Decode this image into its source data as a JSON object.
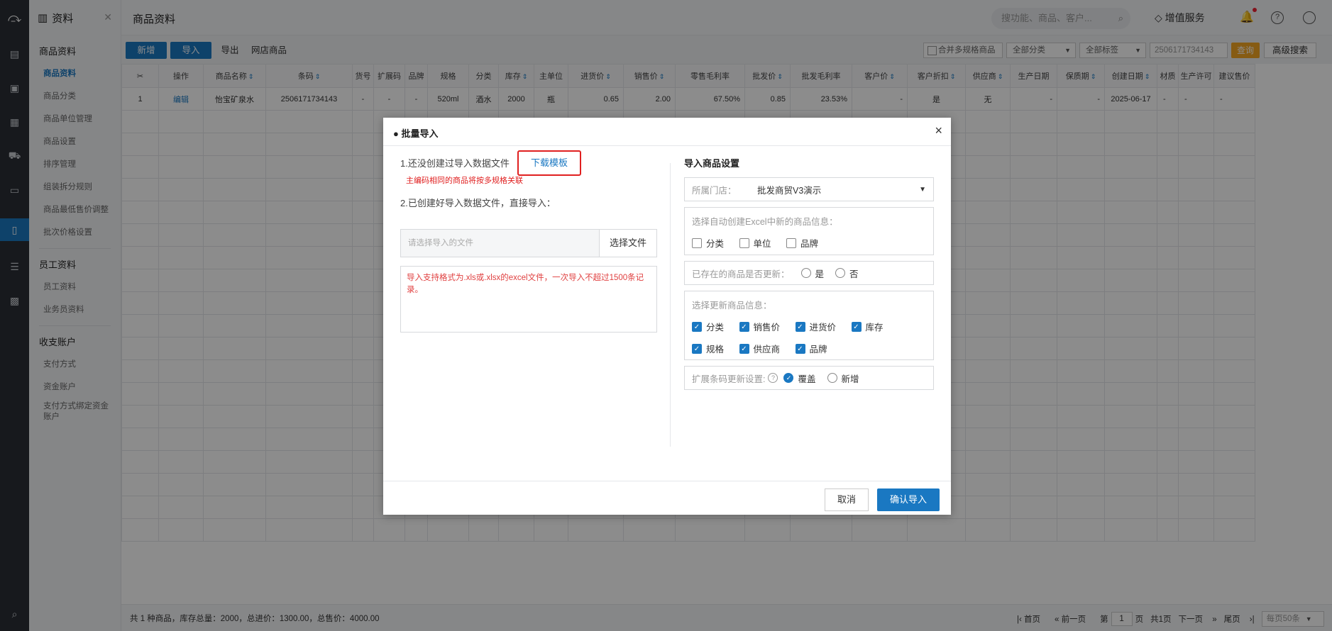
{
  "sidebar": {
    "title": "资料",
    "groups": [
      {
        "label": "商品资料",
        "items": [
          "商品资料",
          "商品分类",
          "商品单位管理",
          "商品设置",
          "排序管理",
          "组装拆分规则",
          "商品最低售价调整",
          "批次价格设置"
        ]
      },
      {
        "label": "员工资料",
        "items": [
          "员工资料",
          "业务员资料"
        ]
      },
      {
        "label": "收支账户",
        "items": [
          "支付方式",
          "资金账户",
          "支付方式绑定资金账户"
        ]
      }
    ]
  },
  "header": {
    "title": "商品资料",
    "search_placeholder": "搜功能、商品、客户...",
    "value_added": "增值服务"
  },
  "toolbar": {
    "new": "新增",
    "import": "导入",
    "export": "导出",
    "online": "网店商品",
    "merge_spec": "合并多规格商品",
    "category": "全部分类",
    "tag": "全部标签",
    "search_value": "2506171734143",
    "query": "查询",
    "advanced": "高级搜索"
  },
  "table": {
    "headers": [
      "",
      "操作",
      "商品名称",
      "条码",
      "货号",
      "扩展码",
      "品牌",
      "规格",
      "分类",
      "库存",
      "主单位",
      "进货价",
      "销售价",
      "零售毛利率",
      "批发价",
      "批发毛利率",
      "客户价",
      "客户折扣",
      "供应商",
      "生产日期",
      "保质期",
      "创建日期",
      "材质",
      "生产许可",
      "建议售价"
    ],
    "rows": [
      [
        "1",
        "编辑",
        "怡宝矿泉水",
        "2506171734143",
        "-",
        "-",
        "-",
        "520ml",
        "酒水",
        "2000",
        "瓶",
        "0.65",
        "2.00",
        "67.50%",
        "0.85",
        "23.53%",
        "-",
        "是",
        "无",
        "-",
        "-",
        "2025-06-17",
        "-",
        "-",
        "-"
      ]
    ]
  },
  "status": {
    "summary": "共 1 种商品，库存总量：2000，总进价：1300.00，总售价：4000.00",
    "first": "首页",
    "prev": "前一页",
    "page_label": "第",
    "page": "1",
    "page_unit": "页",
    "total": "共1页",
    "next": "下一页",
    "last": "尾页",
    "page_size": "每页50条"
  },
  "modal": {
    "title": "批量导入",
    "step1": "1.还没创建过导入数据文件",
    "download": "下载模板",
    "hint": "主编码相同的商品将按多规格关联",
    "step2": "2.已创建好导入数据文件，直接导入：",
    "file_placeholder": "请选择导入的文件",
    "choose_file": "选择文件",
    "note": "导入支持格式为.xls或.xlsx的excel文件，一次导入不超过1500条记录。",
    "settings_title": "导入商品设置",
    "store_label": "所属门店：",
    "store_value": "批发商贸V3演示",
    "auto_create_label": "选择自动创建Excel中新的商品信息：",
    "auto_create_opts": [
      "分类",
      "单位",
      "品牌"
    ],
    "update_existing_label": "已存在的商品是否更新：",
    "yes": "是",
    "no": "否",
    "update_info_label": "选择更新商品信息：",
    "update_opts_row1": [
      "分类",
      "销售价",
      "进货价",
      "库存"
    ],
    "update_opts_row2": [
      "规格",
      "供应商",
      "品牌"
    ],
    "ext_code_label": "扩展条码更新设置:",
    "overwrite": "覆盖",
    "add_new": "新增",
    "cancel": "取消",
    "confirm": "确认导入"
  }
}
